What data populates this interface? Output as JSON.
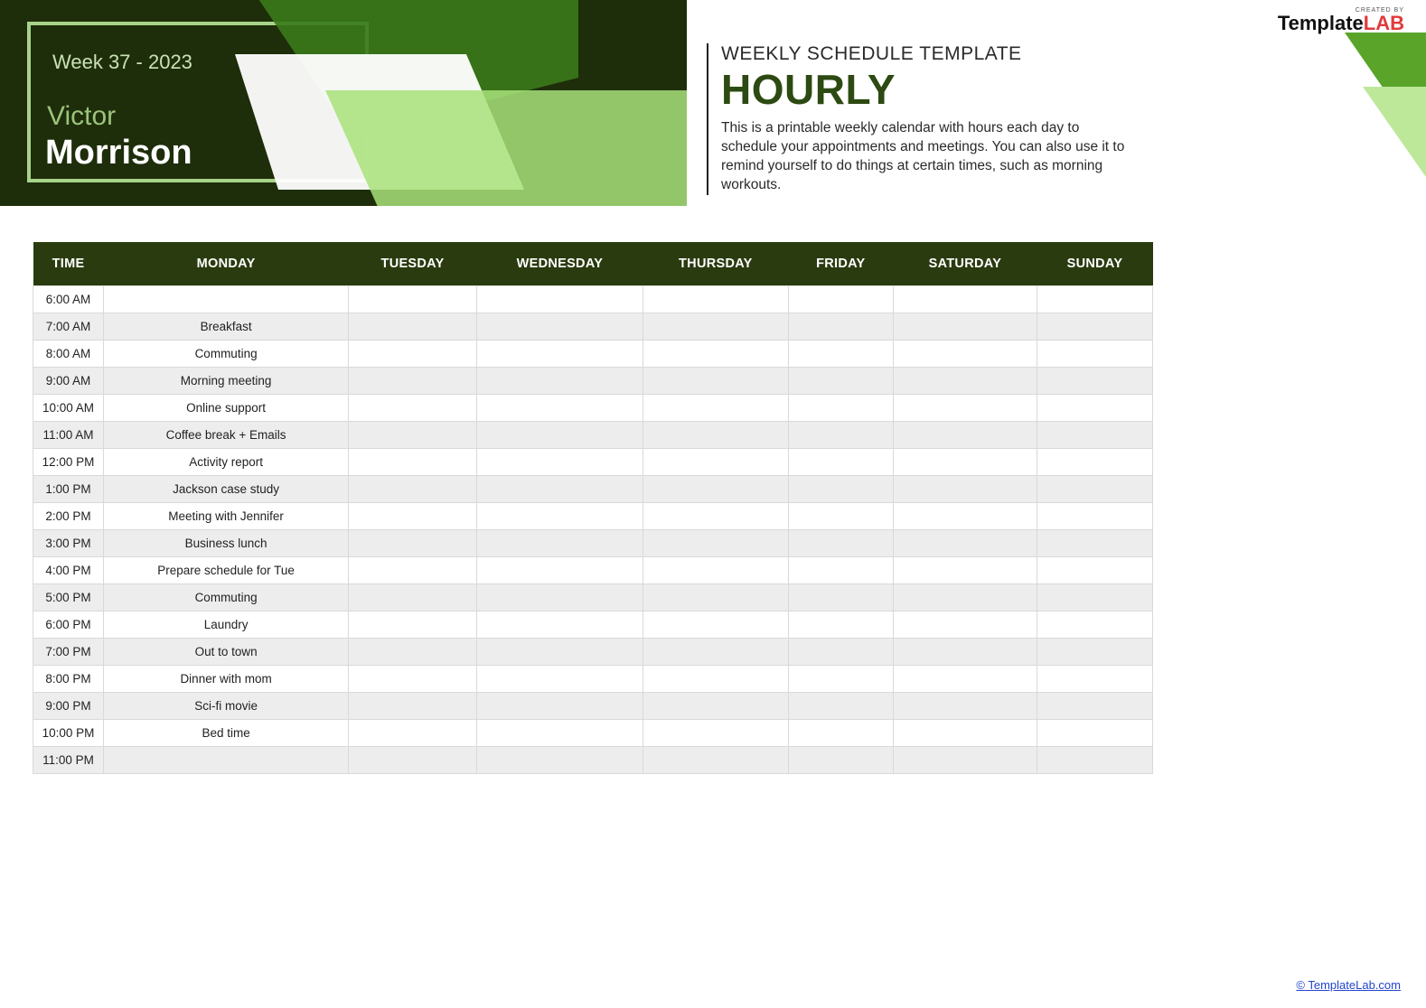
{
  "header": {
    "week_label": "Week 37 - 2023",
    "first_name": "Victor",
    "last_name": "Morrison"
  },
  "logo": {
    "small": "CREATED BY",
    "brand_a": "Template",
    "brand_b": "LAB"
  },
  "desc": {
    "line1": "WEEKLY SCHEDULE TEMPLATE",
    "title": "HOURLY",
    "body": "This is a printable weekly calendar with hours each day to schedule your appointments and meetings. You can also use it to remind yourself to do things at certain times, such as morning workouts."
  },
  "table": {
    "headers": [
      "TIME",
      "MONDAY",
      "TUESDAY",
      "WEDNESDAY",
      "THURSDAY",
      "FRIDAY",
      "SATURDAY",
      "SUNDAY"
    ],
    "rows": [
      {
        "time": "6:00 AM",
        "cells": [
          "",
          "",
          "",
          "",
          "",
          "",
          ""
        ]
      },
      {
        "time": "7:00 AM",
        "cells": [
          "Breakfast",
          "",
          "",
          "",
          "",
          "",
          ""
        ]
      },
      {
        "time": "8:00 AM",
        "cells": [
          "Commuting",
          "",
          "",
          "",
          "",
          "",
          ""
        ]
      },
      {
        "time": "9:00 AM",
        "cells": [
          "Morning meeting",
          "",
          "",
          "",
          "",
          "",
          ""
        ]
      },
      {
        "time": "10:00 AM",
        "cells": [
          "Online support",
          "",
          "",
          "",
          "",
          "",
          ""
        ]
      },
      {
        "time": "11:00 AM",
        "cells": [
          "Coffee break + Emails",
          "",
          "",
          "",
          "",
          "",
          ""
        ]
      },
      {
        "time": "12:00 PM",
        "cells": [
          "Activity report",
          "",
          "",
          "",
          "",
          "",
          ""
        ]
      },
      {
        "time": "1:00 PM",
        "cells": [
          "Jackson case study",
          "",
          "",
          "",
          "",
          "",
          ""
        ]
      },
      {
        "time": "2:00 PM",
        "cells": [
          "Meeting with Jennifer",
          "",
          "",
          "",
          "",
          "",
          ""
        ]
      },
      {
        "time": "3:00 PM",
        "cells": [
          "Business lunch",
          "",
          "",
          "",
          "",
          "",
          ""
        ]
      },
      {
        "time": "4:00 PM",
        "cells": [
          "Prepare schedule for Tue",
          "",
          "",
          "",
          "",
          "",
          ""
        ]
      },
      {
        "time": "5:00 PM",
        "cells": [
          "Commuting",
          "",
          "",
          "",
          "",
          "",
          ""
        ]
      },
      {
        "time": "6:00 PM",
        "cells": [
          "Laundry",
          "",
          "",
          "",
          "",
          "",
          ""
        ]
      },
      {
        "time": "7:00 PM",
        "cells": [
          "Out to town",
          "",
          "",
          "",
          "",
          "",
          ""
        ]
      },
      {
        "time": "8:00 PM",
        "cells": [
          "Dinner with mom",
          "",
          "",
          "",
          "",
          "",
          ""
        ]
      },
      {
        "time": "9:00 PM",
        "cells": [
          "Sci-fi movie",
          "",
          "",
          "",
          "",
          "",
          ""
        ]
      },
      {
        "time": "10:00 PM",
        "cells": [
          "Bed time",
          "",
          "",
          "",
          "",
          "",
          ""
        ]
      },
      {
        "time": "11:00 PM",
        "cells": [
          "",
          "",
          "",
          "",
          "",
          "",
          ""
        ]
      }
    ]
  },
  "footer": {
    "link": "© TemplateLab.com"
  }
}
